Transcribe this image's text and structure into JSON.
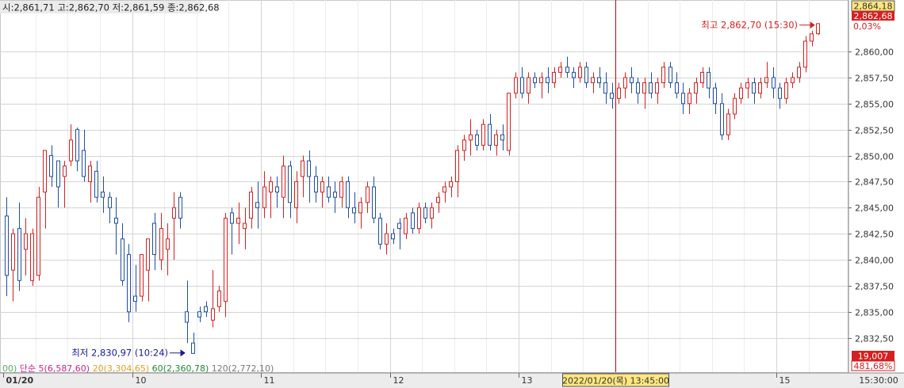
{
  "ohlc_text": "시:2,861,71 고:2,862,70 저:2,861,59 종:2,862,68",
  "chart_data": {
    "type": "candlestick",
    "y_ticks": [
      "2,860,00",
      "2,857,50",
      "2,855,00",
      "2,852,50",
      "2,850,00",
      "2,847,50",
      "2,845,00",
      "2,842,50",
      "2,840,00",
      "2,837,50",
      "2,835,00",
      "2,832,50"
    ],
    "ylim": [
      2829.2,
      2864.8
    ],
    "x_labels": [
      {
        "label": "01/20",
        "index": 0
      },
      {
        "label": "10",
        "index": 20
      },
      {
        "label": "11",
        "index": 40
      },
      {
        "label": "12",
        "index": 60
      },
      {
        "label": "13",
        "index": 80
      },
      {
        "label": "15",
        "index": 120
      }
    ],
    "time_label": "15:30:00",
    "cursor_date_label": "2022/01/20(목) 13:45:00",
    "cursor_index": 95,
    "current_price_label": "2,864,18",
    "last_price_label": "2,862,68",
    "change_label": "0,03%",
    "volume_label": "19,007",
    "volume_pct_label": "481,68%",
    "max_annotation": {
      "label": "최고 2,862,70 (15:30)",
      "index": 126,
      "value": 2862.7
    },
    "min_annotation": {
      "label": "최저 2,830,97 (10:24)",
      "index": 28,
      "value": 2830.97
    },
    "ma_legend": [
      {
        "text": "00)",
        "color": "#55aa55"
      },
      {
        "text": "단순 5(6,587,60)",
        "color": "#cc2288"
      },
      {
        "text": "20(3,304,65)",
        "color": "#e0a020"
      },
      {
        "text": "60(2,360,78)",
        "color": "#228833"
      },
      {
        "text": "120(2,772,10)",
        "color": "#777777"
      }
    ],
    "colors": {
      "up": "#d42020",
      "down": "#1e4fa0",
      "grid": "#d4d4d4",
      "cursor": "#cc0000"
    },
    "candles": [
      [
        2844.2,
        2846.0,
        2836.5,
        2838.5
      ],
      [
        2839.0,
        2843.0,
        2836.0,
        2842.5
      ],
      [
        2843.0,
        2845.5,
        2837.0,
        2838.0
      ],
      [
        2841.0,
        2844.0,
        2838.5,
        2842.5
      ],
      [
        2838.0,
        2843.0,
        2837.5,
        2842.5
      ],
      [
        2838.5,
        2847.0,
        2838.0,
        2846.0
      ],
      [
        2846.5,
        2850.5,
        2843.0,
        2850.5
      ],
      [
        2850.0,
        2851.0,
        2847.0,
        2848.0
      ],
      [
        2849.5,
        2849.5,
        2845.0,
        2847.0
      ],
      [
        2848.0,
        2849.5,
        2845.0,
        2849.0
      ],
      [
        2849.5,
        2853.0,
        2849.0,
        2851.5
      ],
      [
        2852.5,
        2852.7,
        2848.5,
        2849.5
      ],
      [
        2850.5,
        2852.5,
        2847.5,
        2848.0
      ],
      [
        2847.5,
        2849.5,
        2845.5,
        2849.0
      ],
      [
        2848.5,
        2849.5,
        2845.5,
        2846.0
      ],
      [
        2846.5,
        2848.0,
        2844.5,
        2846.0
      ],
      [
        2846.0,
        2846.5,
        2843.5,
        2845.0
      ],
      [
        2844.0,
        2846.0,
        2840.5,
        2843.5
      ],
      [
        2842.0,
        2843.5,
        2837.5,
        2838.0
      ],
      [
        2840.5,
        2841.5,
        2834.0,
        2835.0
      ],
      [
        2836.5,
        2839.5,
        2835.0,
        2836.0
      ],
      [
        2836.5,
        2840.5,
        2836.0,
        2840.5
      ],
      [
        2839.0,
        2842.0,
        2836.0,
        2842.0
      ],
      [
        2843.5,
        2844.5,
        2839.0,
        2840.5
      ],
      [
        2840.0,
        2844.5,
        2839.0,
        2843.0
      ],
      [
        2841.0,
        2843.5,
        2838.5,
        2842.0
      ],
      [
        2844.0,
        2846.5,
        2840.0,
        2845.0
      ],
      [
        2846.0,
        2846.5,
        2843.0,
        2844.0
      ],
      [
        2835.0,
        2838.0,
        2832.0,
        2834.0
      ],
      [
        2832.0,
        2833.0,
        2830.97,
        2831.0
      ],
      [
        2835.0,
        2835.5,
        2834.0,
        2834.5
      ],
      [
        2835.5,
        2836.0,
        2834.5,
        2835.0
      ],
      [
        2834.2,
        2839.0,
        2833.5,
        2835.3
      ],
      [
        2835.5,
        2837.5,
        2835.0,
        2837.0
      ],
      [
        2836.0,
        2844.5,
        2834.5,
        2844.0
      ],
      [
        2844.5,
        2845.0,
        2840.5,
        2843.5
      ],
      [
        2843.5,
        2845.5,
        2841.5,
        2844.0
      ],
      [
        2843.0,
        2845.0,
        2841.0,
        2843.5
      ],
      [
        2844.0,
        2847.0,
        2843.0,
        2846.5
      ],
      [
        2845.5,
        2847.5,
        2843.0,
        2845.0
      ],
      [
        2845.0,
        2848.5,
        2844.0,
        2847.0
      ],
      [
        2846.5,
        2848.0,
        2844.0,
        2847.5
      ],
      [
        2847.0,
        2848.0,
        2845.0,
        2846.5
      ],
      [
        2846.0,
        2850.0,
        2844.0,
        2849.0
      ],
      [
        2849.0,
        2849.5,
        2844.0,
        2845.5
      ],
      [
        2845.0,
        2848.5,
        2843.5,
        2847.5
      ],
      [
        2848.0,
        2850.0,
        2846.0,
        2849.5
      ],
      [
        2849.5,
        2850.5,
        2845.5,
        2848.0
      ],
      [
        2848.0,
        2849.0,
        2845.5,
        2846.5
      ],
      [
        2846.5,
        2848.0,
        2845.0,
        2847.5
      ],
      [
        2847.0,
        2848.0,
        2845.5,
        2846.0
      ],
      [
        2846.5,
        2847.5,
        2844.5,
        2846.0
      ],
      [
        2846.0,
        2848.0,
        2845.0,
        2847.5
      ],
      [
        2847.5,
        2848.0,
        2844.0,
        2845.0
      ],
      [
        2845.0,
        2846.5,
        2843.5,
        2844.5
      ],
      [
        2844.5,
        2846.0,
        2843.0,
        2845.5
      ],
      [
        2845.5,
        2847.5,
        2844.5,
        2847.0
      ],
      [
        2847.0,
        2848.0,
        2843.5,
        2844.0
      ],
      [
        2844.0,
        2844.5,
        2841.0,
        2841.5
      ],
      [
        2841.5,
        2843.5,
        2840.5,
        2842.5
      ],
      [
        2842.5,
        2843.0,
        2841.5,
        2842.0
      ],
      [
        2843.5,
        2844.0,
        2841.0,
        2843.0
      ],
      [
        2842.5,
        2844.5,
        2842.0,
        2844.0
      ],
      [
        2844.5,
        2845.0,
        2842.5,
        2843.0
      ],
      [
        2843.0,
        2845.5,
        2842.5,
        2845.0
      ],
      [
        2845.0,
        2845.5,
        2843.5,
        2844.0
      ],
      [
        2844.0,
        2845.5,
        2843.0,
        2845.0
      ],
      [
        2845.5,
        2846.5,
        2844.5,
        2846.0
      ],
      [
        2846.5,
        2847.5,
        2845.5,
        2847.0
      ],
      [
        2847.0,
        2848.0,
        2846.0,
        2847.5
      ],
      [
        2847.5,
        2851.0,
        2846.0,
        2850.5
      ],
      [
        2850.5,
        2852.0,
        2849.5,
        2851.5
      ],
      [
        2851.5,
        2853.5,
        2850.0,
        2852.0
      ],
      [
        2852.0,
        2852.5,
        2850.5,
        2851.0
      ],
      [
        2851.0,
        2853.5,
        2850.5,
        2853.0
      ],
      [
        2853.0,
        2854.0,
        2850.5,
        2851.0
      ],
      [
        2851.0,
        2852.5,
        2850.0,
        2852.0
      ],
      [
        2852.0,
        2853.0,
        2850.5,
        2851.5
      ],
      [
        2850.5,
        2856.0,
        2850.0,
        2856.0
      ],
      [
        2856.0,
        2858.0,
        2855.5,
        2857.5
      ],
      [
        2857.5,
        2858.5,
        2855.5,
        2856.0
      ],
      [
        2856.0,
        2858.0,
        2855.0,
        2857.5
      ],
      [
        2857.5,
        2858.0,
        2856.5,
        2857.0
      ],
      [
        2857.0,
        2858.0,
        2855.5,
        2857.5
      ],
      [
        2857.5,
        2858.5,
        2856.0,
        2857.0
      ],
      [
        2857.0,
        2858.5,
        2856.5,
        2858.0
      ],
      [
        2858.0,
        2859.0,
        2857.5,
        2858.5
      ],
      [
        2858.5,
        2859.5,
        2857.5,
        2858.0
      ],
      [
        2858.0,
        2858.5,
        2856.5,
        2857.5
      ],
      [
        2857.5,
        2859.0,
        2857.0,
        2858.5
      ],
      [
        2858.5,
        2859.0,
        2856.5,
        2857.0
      ],
      [
        2857.0,
        2858.0,
        2856.0,
        2857.5
      ],
      [
        2857.5,
        2858.5,
        2856.5,
        2857.0
      ],
      [
        2857.0,
        2858.0,
        2855.0,
        2856.0
      ],
      [
        2856.0,
        2857.0,
        2854.5,
        2855.5
      ],
      [
        2855.5,
        2857.0,
        2855.0,
        2856.5
      ],
      [
        2856.5,
        2858.0,
        2855.5,
        2857.5
      ],
      [
        2857.5,
        2858.5,
        2856.0,
        2857.0
      ],
      [
        2857.0,
        2857.5,
        2855.0,
        2856.0
      ],
      [
        2856.0,
        2857.5,
        2854.5,
        2857.0
      ],
      [
        2857.0,
        2858.0,
        2855.5,
        2856.0
      ],
      [
        2856.0,
        2857.5,
        2855.0,
        2857.0
      ],
      [
        2857.0,
        2859.0,
        2856.5,
        2858.5
      ],
      [
        2858.5,
        2859.0,
        2856.5,
        2857.0
      ],
      [
        2857.0,
        2858.0,
        2855.5,
        2856.0
      ],
      [
        2856.0,
        2857.0,
        2854.0,
        2855.0
      ],
      [
        2855.0,
        2856.5,
        2854.0,
        2856.0
      ],
      [
        2856.0,
        2857.5,
        2855.0,
        2857.0
      ],
      [
        2857.0,
        2858.5,
        2856.5,
        2858.0
      ],
      [
        2858.0,
        2858.5,
        2855.5,
        2856.5
      ],
      [
        2856.5,
        2857.0,
        2854.0,
        2855.0
      ],
      [
        2855.0,
        2856.0,
        2851.5,
        2852.0
      ],
      [
        2852.0,
        2854.5,
        2851.5,
        2854.0
      ],
      [
        2854.0,
        2856.0,
        2853.5,
        2855.5
      ],
      [
        2855.5,
        2857.0,
        2855.0,
        2856.5
      ],
      [
        2856.5,
        2857.5,
        2855.5,
        2857.0
      ],
      [
        2857.0,
        2857.5,
        2855.0,
        2856.0
      ],
      [
        2856.0,
        2857.5,
        2855.5,
        2857.0
      ],
      [
        2857.0,
        2859.0,
        2856.5,
        2857.5
      ],
      [
        2857.5,
        2858.5,
        2855.5,
        2856.5
      ],
      [
        2856.5,
        2857.0,
        2854.5,
        2855.5
      ],
      [
        2855.5,
        2857.5,
        2855.0,
        2857.0
      ],
      [
        2857.0,
        2858.0,
        2856.5,
        2857.5
      ],
      [
        2857.5,
        2859.0,
        2857.0,
        2858.5
      ],
      [
        2858.5,
        2861.5,
        2858.0,
        2861.0
      ],
      [
        2861.0,
        2862.0,
        2860.5,
        2861.7
      ],
      [
        2861.71,
        2862.7,
        2861.59,
        2862.68
      ]
    ]
  }
}
